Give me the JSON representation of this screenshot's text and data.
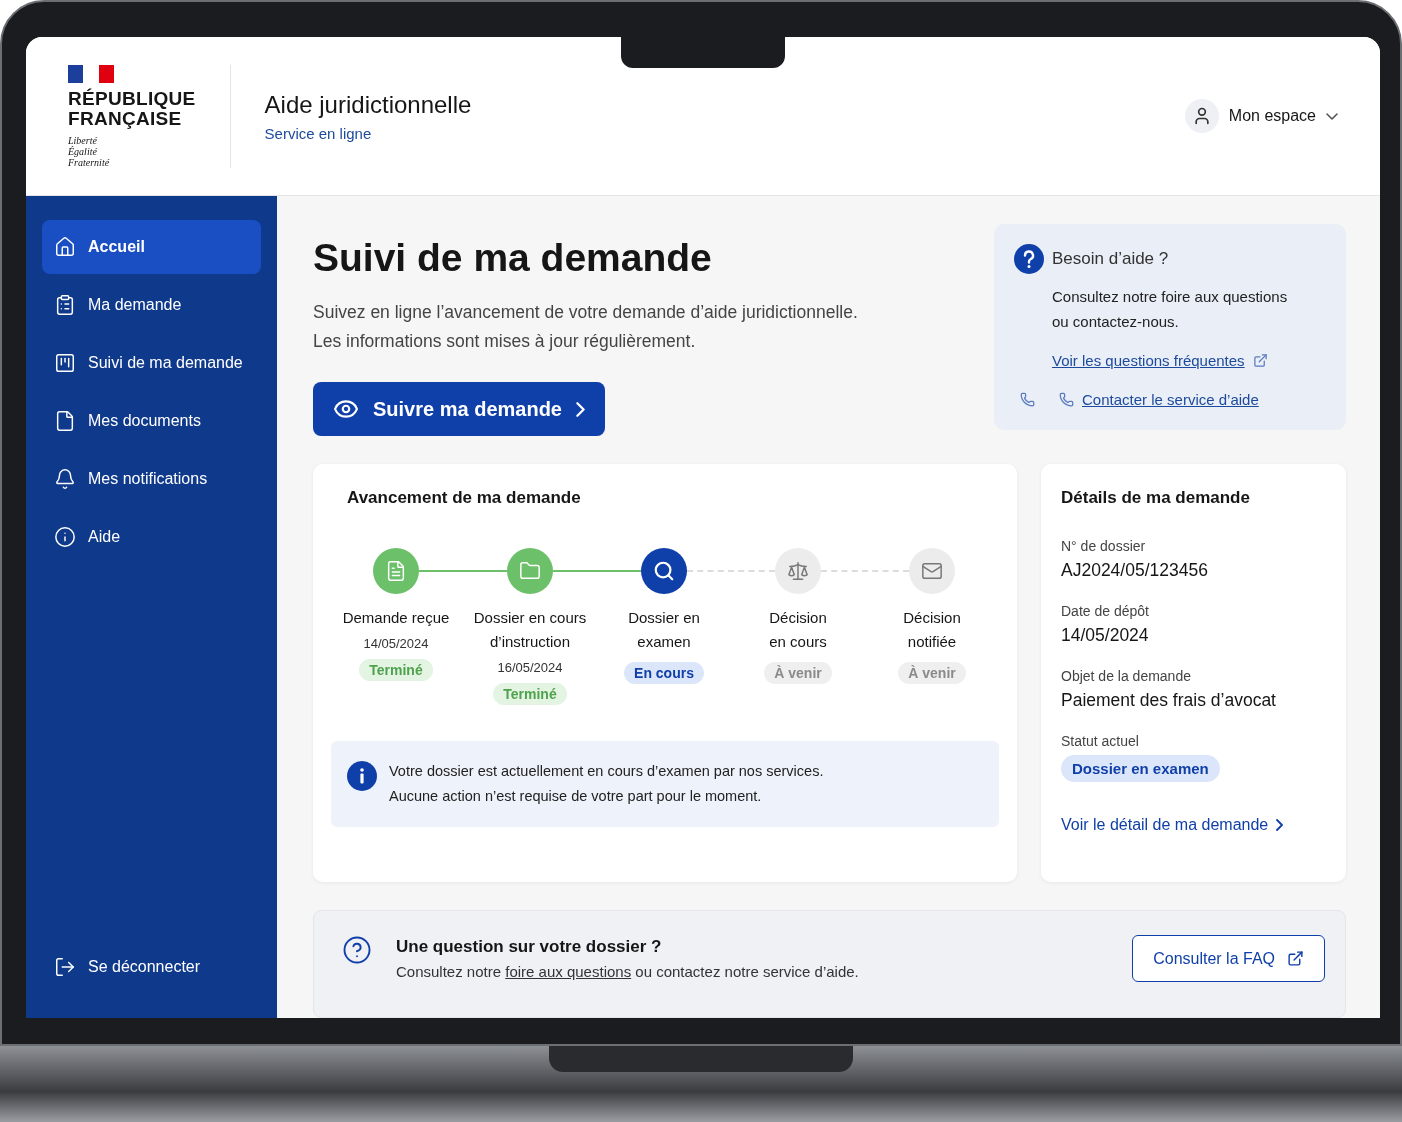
{
  "header": {
    "logo_lines": [
      "RÉPUBLIQUE",
      "FRANÇAISE"
    ],
    "motto": [
      "Liberté",
      "Égalité",
      "Fraternité"
    ],
    "title": "Aide juridictionnelle",
    "subtitle": "Service en ligne",
    "account": "Mon espace"
  },
  "sidebar": {
    "items": [
      {
        "label": "Accueil",
        "selected": true
      },
      {
        "label": "Ma demande",
        "selected": false
      },
      {
        "label": "Suivi de ma demande",
        "selected": false
      },
      {
        "label": "Mes documents",
        "selected": false
      },
      {
        "label": "Mes notifications",
        "selected": false
      },
      {
        "label": "Aide",
        "selected": false
      }
    ],
    "logout": "Se déconnecter"
  },
  "hero": {
    "title": "Suivi de ma demande",
    "intro": [
      "Suivez en ligne l’avancement de votre demande d’aide juridictionnelle.",
      "Les informations sont mises à jour régulièrement."
    ],
    "button": "Suivre ma demande"
  },
  "help_card": {
    "title": "Besoin d’aide ?",
    "text": [
      "Consultez notre foire aux questions",
      "ou contactez-nous."
    ],
    "faq_link": "Voir les questions fréquentes",
    "contact_link": "Contacter le service d’aide"
  },
  "progress": {
    "title": "Avancement de ma demande",
    "steps": [
      {
        "label": [
          "Demande reçue"
        ],
        "date": "14/05/2024",
        "status": "Terminé",
        "kind": "done"
      },
      {
        "label": [
          "Dossier en cours",
          "d’instruction"
        ],
        "date": "16/05/2024",
        "status": "Terminé",
        "kind": "done"
      },
      {
        "label": [
          "Dossier en",
          "examen"
        ],
        "status": "En cours",
        "kind": "current"
      },
      {
        "label": [
          "Décision",
          "en cours"
        ],
        "status": "À venir",
        "kind": "upcoming"
      },
      {
        "label": [
          "Décision",
          "notifiée"
        ],
        "status": "À venir",
        "kind": "upcoming"
      }
    ],
    "notice": [
      "Votre dossier est actuellement en cours d’examen par nos services.",
      "Aucune action n’est requise de votre part pour le moment."
    ]
  },
  "details": {
    "title": "Détails de ma demande",
    "fields": [
      {
        "label": "N° de dossier",
        "value": "AJ2024/05/123456"
      },
      {
        "label": "Date de dépôt",
        "value": "14/05/2024"
      },
      {
        "label": "Objet de la demande",
        "value": "Paiement des frais d’avocat"
      }
    ],
    "status_label": "Statut actuel",
    "status": "Dossier en examen",
    "link": "Voir le détail de ma demande"
  },
  "faq_bar": {
    "title": "Une question sur votre dossier ?",
    "text_before": "Consultez notre ",
    "link": "foire aux questions",
    "text_after": " ou contactez notre service d’aide.",
    "button": "Consulter la FAQ"
  }
}
